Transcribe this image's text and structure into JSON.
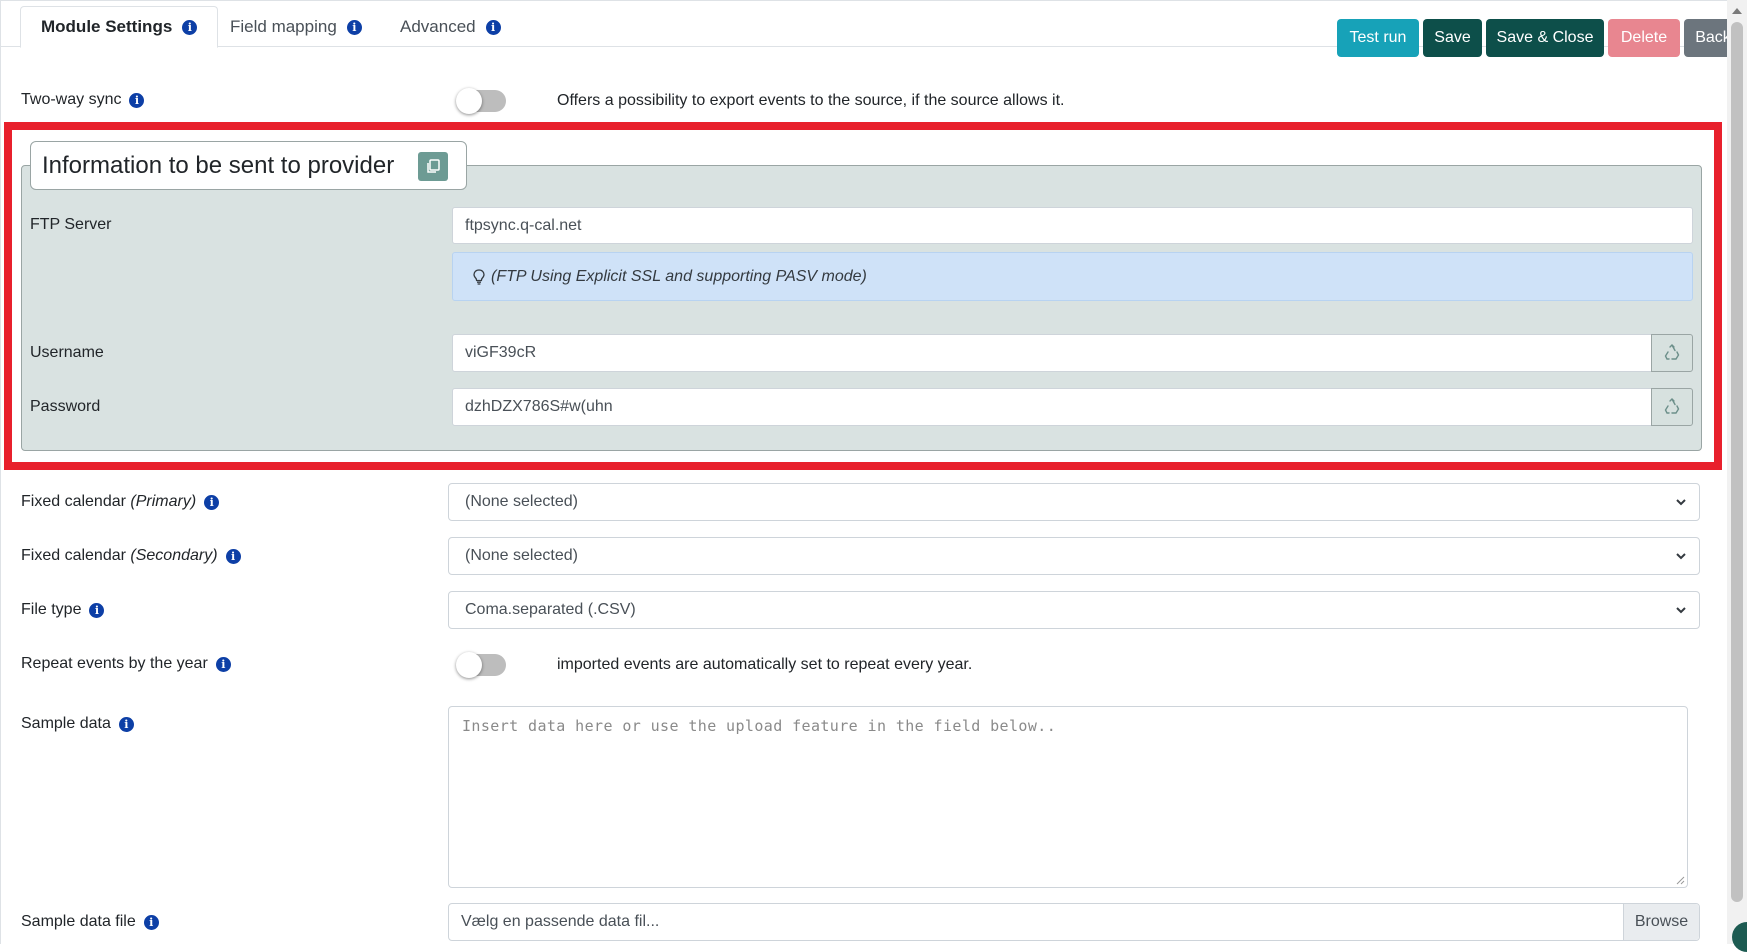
{
  "tabs": [
    {
      "label": "Module Settings",
      "active": true
    },
    {
      "label": "Field mapping",
      "active": false
    },
    {
      "label": "Advanced",
      "active": false
    }
  ],
  "toolbar": {
    "test_run": "Test run",
    "save": "Save",
    "save_close": "Save & Close",
    "delete": "Delete",
    "back": "Back"
  },
  "two_way_sync": {
    "label": "Two-way sync",
    "description": "Offers a possibility to export events to the source, if the source allows it.",
    "enabled": false
  },
  "provider_info": {
    "legend": "Information to be sent to provider",
    "ftp_server": {
      "label": "FTP Server",
      "value": "ftpsync.q-cal.net"
    },
    "hint": "(FTP Using Explicit SSL and supporting PASV mode)",
    "username": {
      "label": "Username",
      "value": "viGF39cR"
    },
    "password": {
      "label": "Password",
      "value": "dzhDZX786S#w(uhn"
    }
  },
  "fixed_primary": {
    "label": "Fixed calendar",
    "qualifier": "(Primary)",
    "value": "(None selected)"
  },
  "fixed_secondary": {
    "label": "Fixed calendar",
    "qualifier": "(Secondary)",
    "value": "(None selected)"
  },
  "file_type": {
    "label": "File type",
    "value": "Coma.separated (.CSV)"
  },
  "repeat_events": {
    "label": "Repeat events by the year",
    "description": "imported events are automatically set to repeat every year.",
    "enabled": false
  },
  "sample_data": {
    "label": "Sample data",
    "placeholder": "Insert data here or use the upload feature in the field below.."
  },
  "sample_file": {
    "label": "Sample data file",
    "placeholder": "Vælg en passende data fil...",
    "browse": "Browse"
  },
  "colors": {
    "highlight": "#e8202c",
    "primary_dark": "#0d4f4a",
    "teal": "#17a2b8",
    "info_icon": "#0d3fa6"
  }
}
